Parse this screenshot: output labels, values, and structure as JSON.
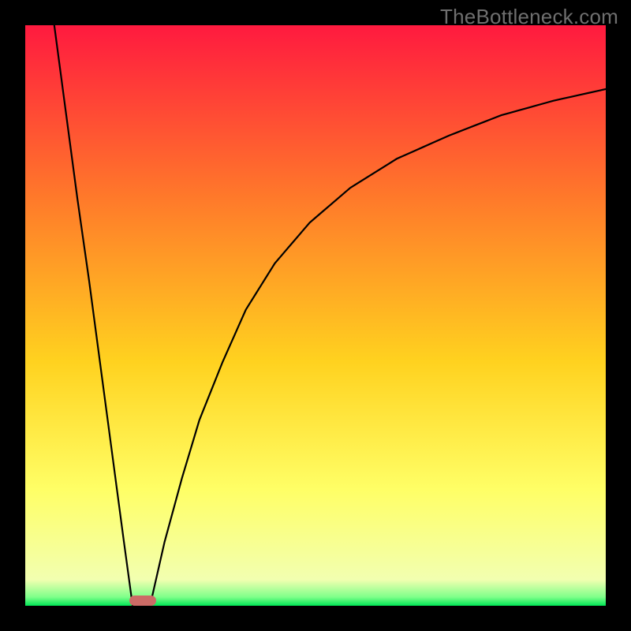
{
  "watermark": "TheBottleneck.com",
  "colors": {
    "frame": "#000000",
    "gradient_top": "#ff1a3f",
    "gradient_mid_upper": "#ff7a2a",
    "gradient_mid": "#ffd21f",
    "gradient_mid_lower": "#ffff66",
    "gradient_bottom": "#00e756",
    "curve": "#000000",
    "marker": "#cc6b66"
  },
  "chart_data": {
    "type": "line",
    "title": "",
    "xlabel": "",
    "ylabel": "",
    "xlim": [
      0,
      100
    ],
    "ylim": [
      0,
      100
    ],
    "series": [
      {
        "name": "left-branch",
        "x": [
          5,
          7,
          9,
          11,
          13,
          15,
          17,
          18.5
        ],
        "values": [
          100,
          85,
          70,
          56,
          41,
          26,
          11,
          0
        ]
      },
      {
        "name": "right-branch",
        "x": [
          21.5,
          24,
          27,
          30,
          34,
          38,
          43,
          49,
          56,
          64,
          73,
          82,
          91,
          100
        ],
        "values": [
          0,
          11,
          22,
          32,
          42,
          51,
          59,
          66,
          72,
          77,
          81,
          84.5,
          87,
          89
        ]
      }
    ],
    "marker": {
      "x_start": 18,
      "x_end": 22.5,
      "y": 0,
      "height_frac": 0.018
    },
    "gradient_stops": [
      {
        "offset": 0.0,
        "color": "#ff1a3f"
      },
      {
        "offset": 0.3,
        "color": "#ff7a2a"
      },
      {
        "offset": 0.58,
        "color": "#ffd21f"
      },
      {
        "offset": 0.8,
        "color": "#ffff66"
      },
      {
        "offset": 0.955,
        "color": "#f2ffb0"
      },
      {
        "offset": 0.985,
        "color": "#7fff8a"
      },
      {
        "offset": 1.0,
        "color": "#00e756"
      }
    ]
  }
}
